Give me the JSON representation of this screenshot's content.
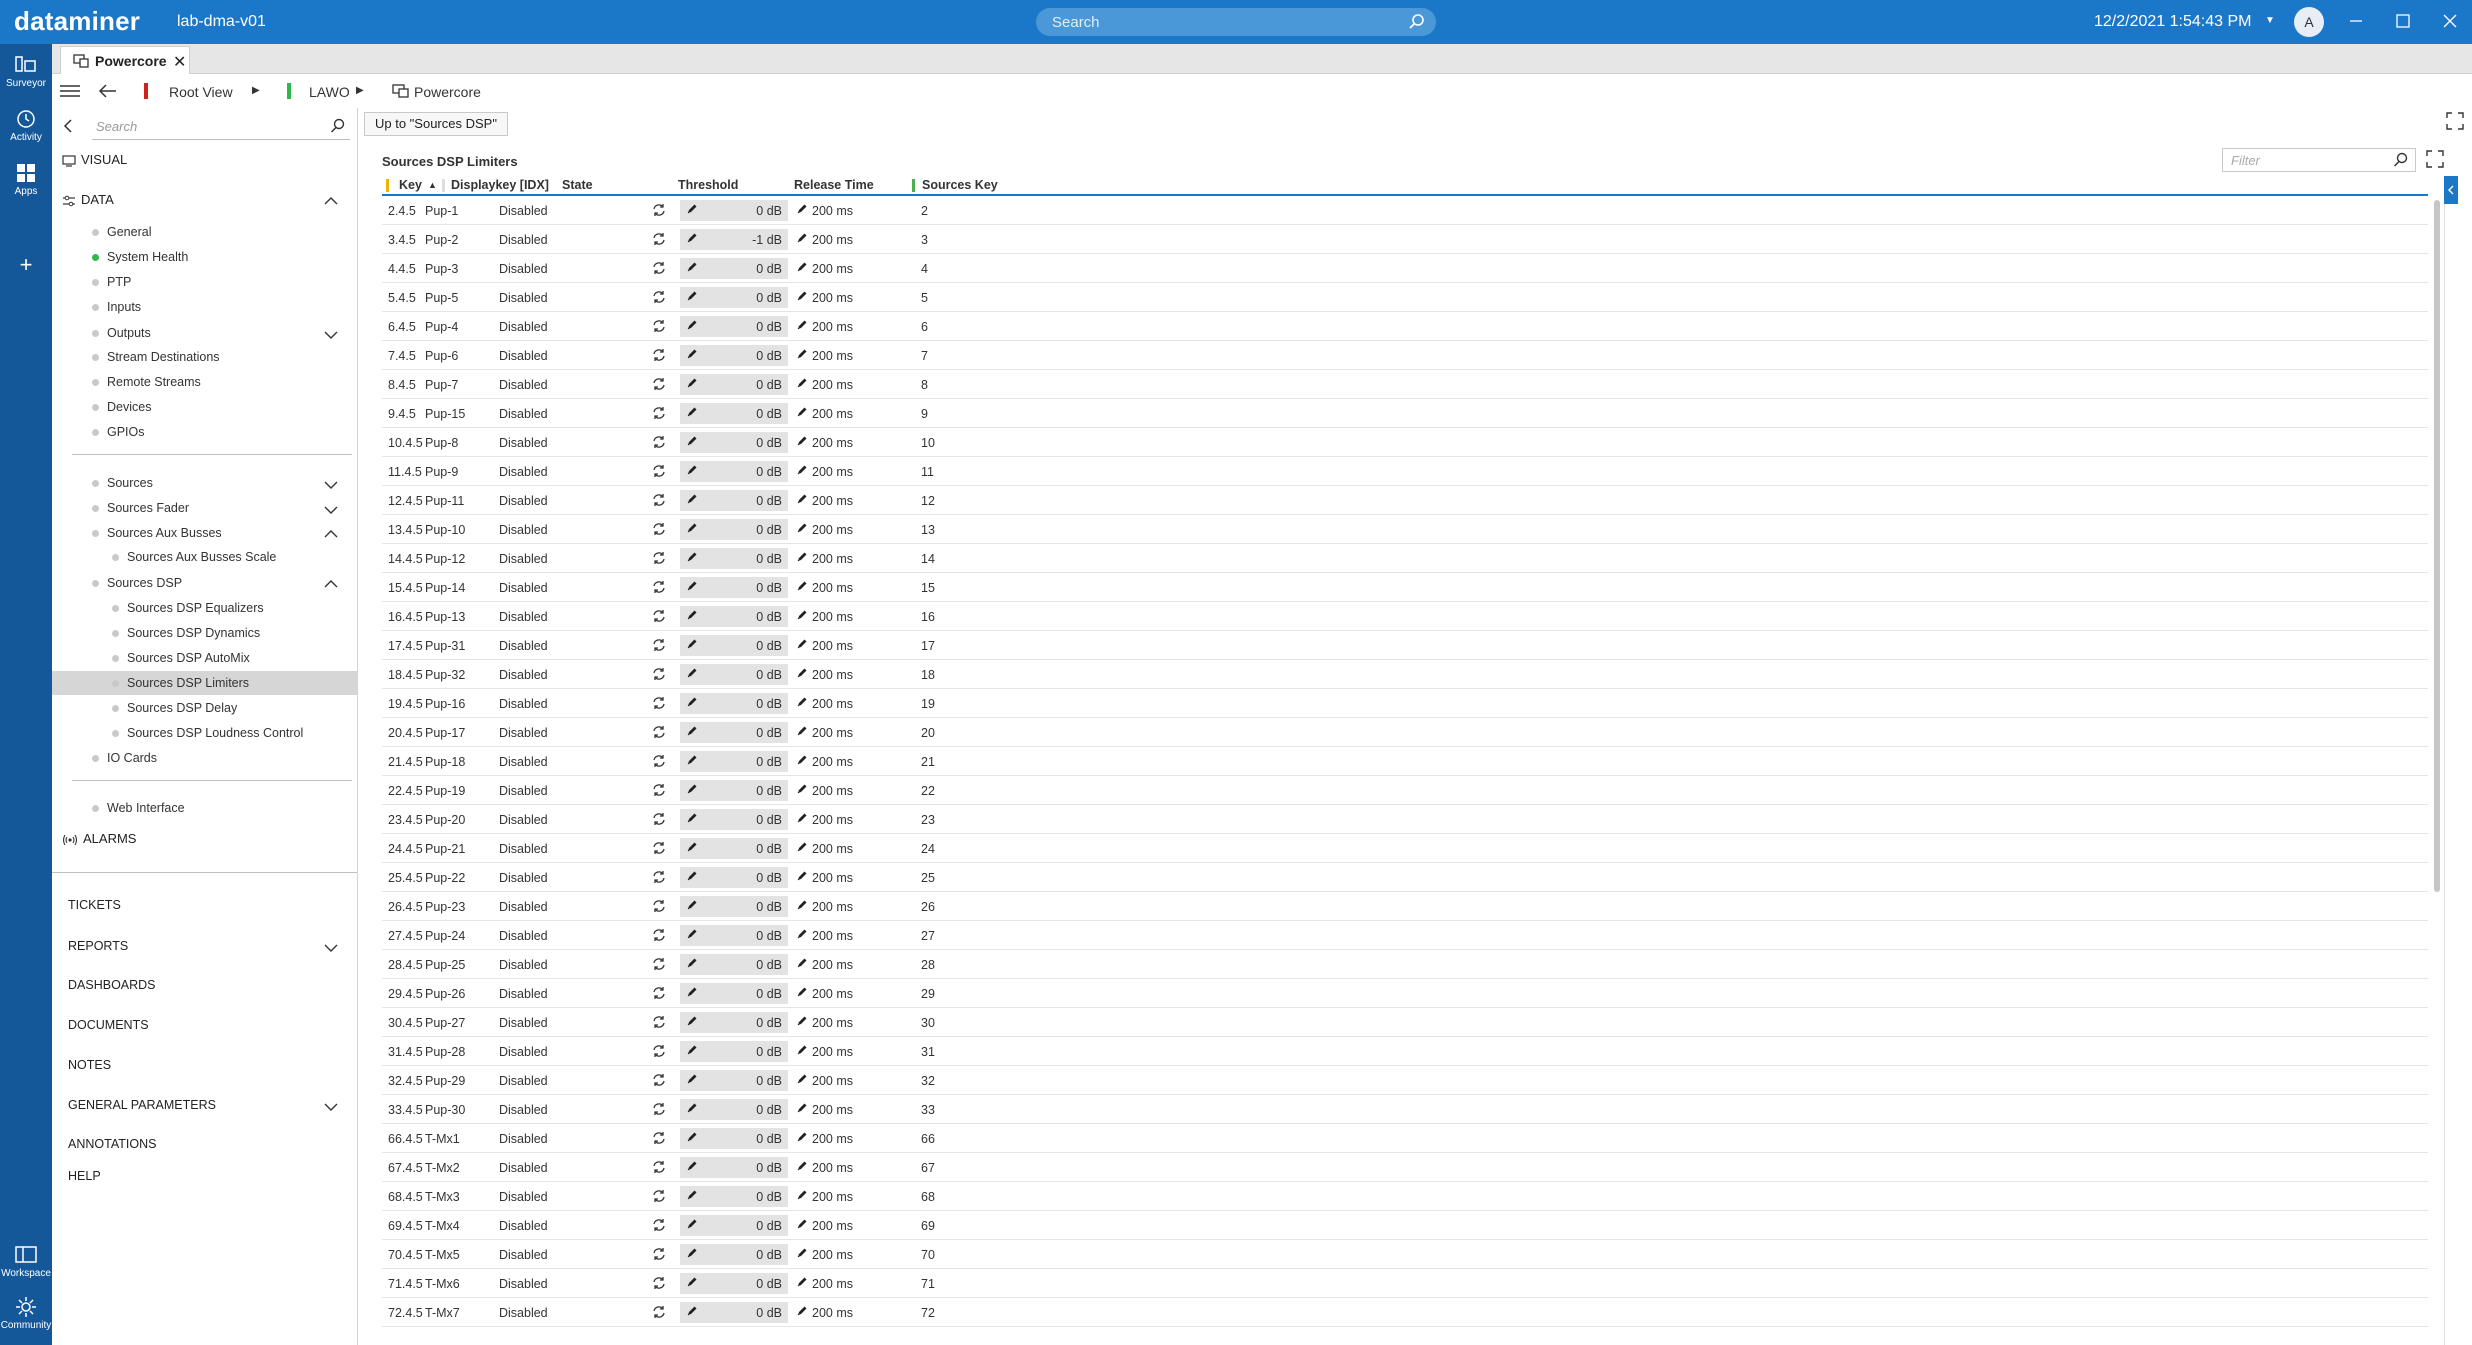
{
  "app": {
    "brand": "dataminer",
    "cluster": "lab-dma-v01",
    "search_placeholder": "Search",
    "datetime": "12/2/2021 1:54:43 PM",
    "user_initial": "A"
  },
  "rail": {
    "items": [
      {
        "label": "Surveyor",
        "icon": "surveyor-icon"
      },
      {
        "label": "Activity",
        "icon": "activity-icon"
      },
      {
        "label": "Apps",
        "icon": "apps-icon"
      },
      {
        "label": "+",
        "icon": "add-icon"
      },
      {
        "label": "Workspace",
        "icon": "workspace-icon"
      },
      {
        "label": "Community",
        "icon": "community-icon"
      }
    ]
  },
  "tab": {
    "label": "Powercore"
  },
  "breadcrumb": {
    "root": "Root View",
    "level1": "LAWO",
    "level2": "Powercore"
  },
  "nav": {
    "search_placeholder": "Search",
    "visual": "VISUAL",
    "data": "DATA",
    "alarms": "ALARMS",
    "group1": [
      {
        "label": "General",
        "status": "grey"
      },
      {
        "label": "System Health",
        "status": "green"
      },
      {
        "label": "PTP",
        "status": "grey"
      },
      {
        "label": "Inputs",
        "status": "grey"
      },
      {
        "label": "Outputs",
        "status": "grey"
      },
      {
        "label": "Stream Destinations",
        "status": "grey"
      },
      {
        "label": "Remote Streams",
        "status": "grey"
      },
      {
        "label": "Devices",
        "status": "grey"
      },
      {
        "label": "GPIOs",
        "status": "grey"
      }
    ],
    "group2": [
      {
        "label": "Sources"
      },
      {
        "label": "Sources Fader"
      },
      {
        "label": "Sources Aux Busses"
      },
      {
        "label": "Sources Aux Busses Scale"
      },
      {
        "label": "Sources DSP"
      },
      {
        "label": "Sources DSP Equalizers"
      },
      {
        "label": "Sources DSP Dynamics"
      },
      {
        "label": "Sources DSP AutoMix"
      },
      {
        "label": "Sources DSP Limiters"
      },
      {
        "label": "Sources DSP Delay"
      },
      {
        "label": "Sources DSP Loudness Control"
      },
      {
        "label": "IO Cards"
      }
    ],
    "group3": [
      {
        "label": "Web Interface"
      }
    ],
    "bottom": [
      {
        "label": "TICKETS"
      },
      {
        "label": "REPORTS"
      },
      {
        "label": "DASHBOARDS"
      },
      {
        "label": "DOCUMENTS"
      },
      {
        "label": "NOTES"
      },
      {
        "label": "GENERAL PARAMETERS"
      },
      {
        "label": "ANNOTATIONS"
      },
      {
        "label": "HELP"
      }
    ]
  },
  "main": {
    "up_button": "Up to \"Sources DSP\"",
    "table_title": "Sources DSP Limiters",
    "filter_placeholder": "Filter",
    "columns": [
      "Key",
      "Displaykey [IDX]",
      "State",
      "Threshold",
      "Release Time",
      "Sources Key"
    ],
    "rows": [
      [
        "2.4.5",
        "Pup-1",
        "Disabled",
        "0 dB",
        "200 ms",
        "2"
      ],
      [
        "3.4.5",
        "Pup-2",
        "Disabled",
        "-1 dB",
        "200 ms",
        "3"
      ],
      [
        "4.4.5",
        "Pup-3",
        "Disabled",
        "0 dB",
        "200 ms",
        "4"
      ],
      [
        "5.4.5",
        "Pup-5",
        "Disabled",
        "0 dB",
        "200 ms",
        "5"
      ],
      [
        "6.4.5",
        "Pup-4",
        "Disabled",
        "0 dB",
        "200 ms",
        "6"
      ],
      [
        "7.4.5",
        "Pup-6",
        "Disabled",
        "0 dB",
        "200 ms",
        "7"
      ],
      [
        "8.4.5",
        "Pup-7",
        "Disabled",
        "0 dB",
        "200 ms",
        "8"
      ],
      [
        "9.4.5",
        "Pup-15",
        "Disabled",
        "0 dB",
        "200 ms",
        "9"
      ],
      [
        "10.4.5",
        "Pup-8",
        "Disabled",
        "0 dB",
        "200 ms",
        "10"
      ],
      [
        "11.4.5",
        "Pup-9",
        "Disabled",
        "0 dB",
        "200 ms",
        "11"
      ],
      [
        "12.4.5",
        "Pup-11",
        "Disabled",
        "0 dB",
        "200 ms",
        "12"
      ],
      [
        "13.4.5",
        "Pup-10",
        "Disabled",
        "0 dB",
        "200 ms",
        "13"
      ],
      [
        "14.4.5",
        "Pup-12",
        "Disabled",
        "0 dB",
        "200 ms",
        "14"
      ],
      [
        "15.4.5",
        "Pup-14",
        "Disabled",
        "0 dB",
        "200 ms",
        "15"
      ],
      [
        "16.4.5",
        "Pup-13",
        "Disabled",
        "0 dB",
        "200 ms",
        "16"
      ],
      [
        "17.4.5",
        "Pup-31",
        "Disabled",
        "0 dB",
        "200 ms",
        "17"
      ],
      [
        "18.4.5",
        "Pup-32",
        "Disabled",
        "0 dB",
        "200 ms",
        "18"
      ],
      [
        "19.4.5",
        "Pup-16",
        "Disabled",
        "0 dB",
        "200 ms",
        "19"
      ],
      [
        "20.4.5",
        "Pup-17",
        "Disabled",
        "0 dB",
        "200 ms",
        "20"
      ],
      [
        "21.4.5",
        "Pup-18",
        "Disabled",
        "0 dB",
        "200 ms",
        "21"
      ],
      [
        "22.4.5",
        "Pup-19",
        "Disabled",
        "0 dB",
        "200 ms",
        "22"
      ],
      [
        "23.4.5",
        "Pup-20",
        "Disabled",
        "0 dB",
        "200 ms",
        "23"
      ],
      [
        "24.4.5",
        "Pup-21",
        "Disabled",
        "0 dB",
        "200 ms",
        "24"
      ],
      [
        "25.4.5",
        "Pup-22",
        "Disabled",
        "0 dB",
        "200 ms",
        "25"
      ],
      [
        "26.4.5",
        "Pup-23",
        "Disabled",
        "0 dB",
        "200 ms",
        "26"
      ],
      [
        "27.4.5",
        "Pup-24",
        "Disabled",
        "0 dB",
        "200 ms",
        "27"
      ],
      [
        "28.4.5",
        "Pup-25",
        "Disabled",
        "0 dB",
        "200 ms",
        "28"
      ],
      [
        "29.4.5",
        "Pup-26",
        "Disabled",
        "0 dB",
        "200 ms",
        "29"
      ],
      [
        "30.4.5",
        "Pup-27",
        "Disabled",
        "0 dB",
        "200 ms",
        "30"
      ],
      [
        "31.4.5",
        "Pup-28",
        "Disabled",
        "0 dB",
        "200 ms",
        "31"
      ],
      [
        "32.4.5",
        "Pup-29",
        "Disabled",
        "0 dB",
        "200 ms",
        "32"
      ],
      [
        "33.4.5",
        "Pup-30",
        "Disabled",
        "0 dB",
        "200 ms",
        "33"
      ],
      [
        "66.4.5",
        "T-Mx1",
        "Disabled",
        "0 dB",
        "200 ms",
        "66"
      ],
      [
        "67.4.5",
        "T-Mx2",
        "Disabled",
        "0 dB",
        "200 ms",
        "67"
      ],
      [
        "68.4.5",
        "T-Mx3",
        "Disabled",
        "0 dB",
        "200 ms",
        "68"
      ],
      [
        "69.4.5",
        "T-Mx4",
        "Disabled",
        "0 dB",
        "200 ms",
        "69"
      ],
      [
        "70.4.5",
        "T-Mx5",
        "Disabled",
        "0 dB",
        "200 ms",
        "70"
      ],
      [
        "71.4.5",
        "T-Mx6",
        "Disabled",
        "0 dB",
        "200 ms",
        "71"
      ],
      [
        "72.4.5",
        "T-Mx7",
        "Disabled",
        "0 dB",
        "200 ms",
        "72"
      ]
    ]
  },
  "colors": {
    "topbar": "#1b78c8",
    "rail": "#15589a",
    "status_green": "#2fb84a",
    "key_marker": "#f0b400",
    "selection": "#d6d6d6"
  }
}
